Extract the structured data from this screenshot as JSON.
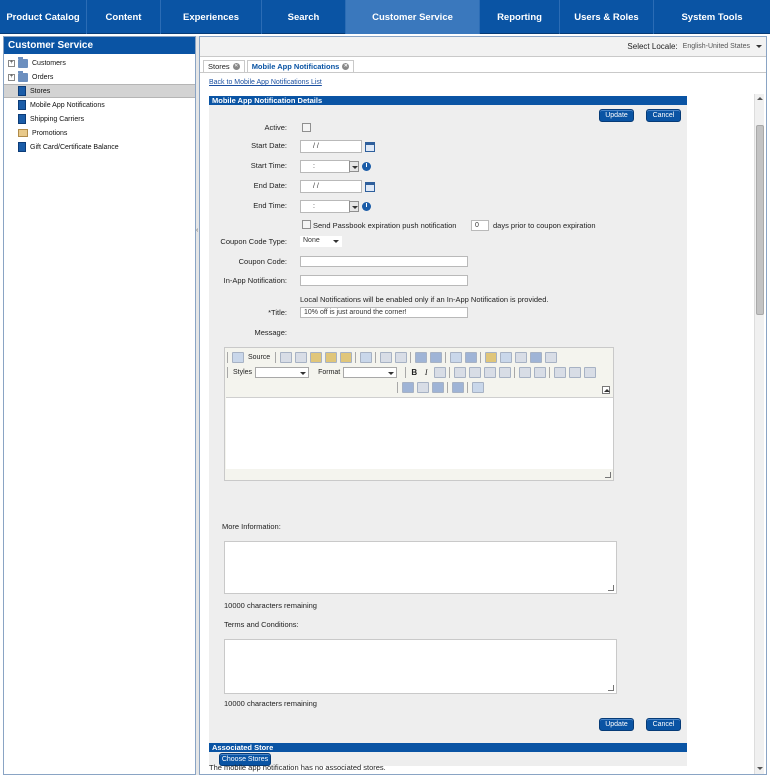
{
  "nav": {
    "items": [
      {
        "label": "Product Catalog"
      },
      {
        "label": "Content"
      },
      {
        "label": "Experiences"
      },
      {
        "label": "Search"
      },
      {
        "label": "Customer Service"
      },
      {
        "label": "Reporting"
      },
      {
        "label": "Users & Roles"
      },
      {
        "label": "System Tools"
      }
    ],
    "active": "Customer Service"
  },
  "sidebar": {
    "title": "Customer Service",
    "items": [
      {
        "label": "Customers",
        "icon": "folder-icon"
      },
      {
        "label": "Orders",
        "icon": "folder-icon"
      },
      {
        "label": "Stores",
        "icon": "store-icon"
      },
      {
        "label": "Mobile App Notifications",
        "icon": "document-icon"
      },
      {
        "label": "Shipping Carriers",
        "icon": "document-icon"
      },
      {
        "label": "Promotions",
        "icon": "promotion-icon"
      },
      {
        "label": "Gift Card/Certificate Balance",
        "icon": "document-icon"
      }
    ],
    "selected": "Stores"
  },
  "locale": {
    "label": "Select Locale:",
    "value": "English-United States"
  },
  "tabs": [
    {
      "label": "Stores"
    },
    {
      "label": "Mobile App Notifications"
    }
  ],
  "back_link": "Back to Mobile App Notifications List",
  "details": {
    "header": "Mobile App Notification Details",
    "update_label": "Update",
    "cancel_label": "Cancel",
    "active_label": "Active:",
    "start_date_label": "Start Date:",
    "start_date_value": " /     /",
    "start_time_label": "Start Time:",
    "start_time_value": ":",
    "end_date_label": "End Date:",
    "end_date_value": " /     /",
    "end_time_label": "End Time:",
    "end_time_value": ":",
    "passbook_label": "Send Passbook expiration push notification",
    "passbook_days_value": "0",
    "passbook_suffix": "days prior to coupon expiration",
    "coupon_type_label": "Coupon Code Type:",
    "coupon_type_value": "None",
    "coupon_code_label": "Coupon Code:",
    "in_app_label": "In-App Notification:",
    "local_note": "Local Notifications will be enabled only if an In-App Notification is provided.",
    "title_label": "*Title:",
    "title_value": "10% off is just around the corner!",
    "message_label": "Message:",
    "editor": {
      "source_label": "Source",
      "styles_label": "Styles",
      "format_label": "Format"
    },
    "more_info_label": "More Information:",
    "more_info_remaining": "10000 characters remaining",
    "terms_label": "Terms and Conditions:",
    "terms_remaining": "10000  characters remaining"
  },
  "associated": {
    "header": "Associated Store",
    "choose_label": "Choose Stores",
    "empty_note": "The mobile app notification has no associated stores."
  },
  "colors": {
    "brand_blue": "#0a54a4",
    "nav_active": "#3a78bd",
    "form_bg": "#eeeeee"
  }
}
